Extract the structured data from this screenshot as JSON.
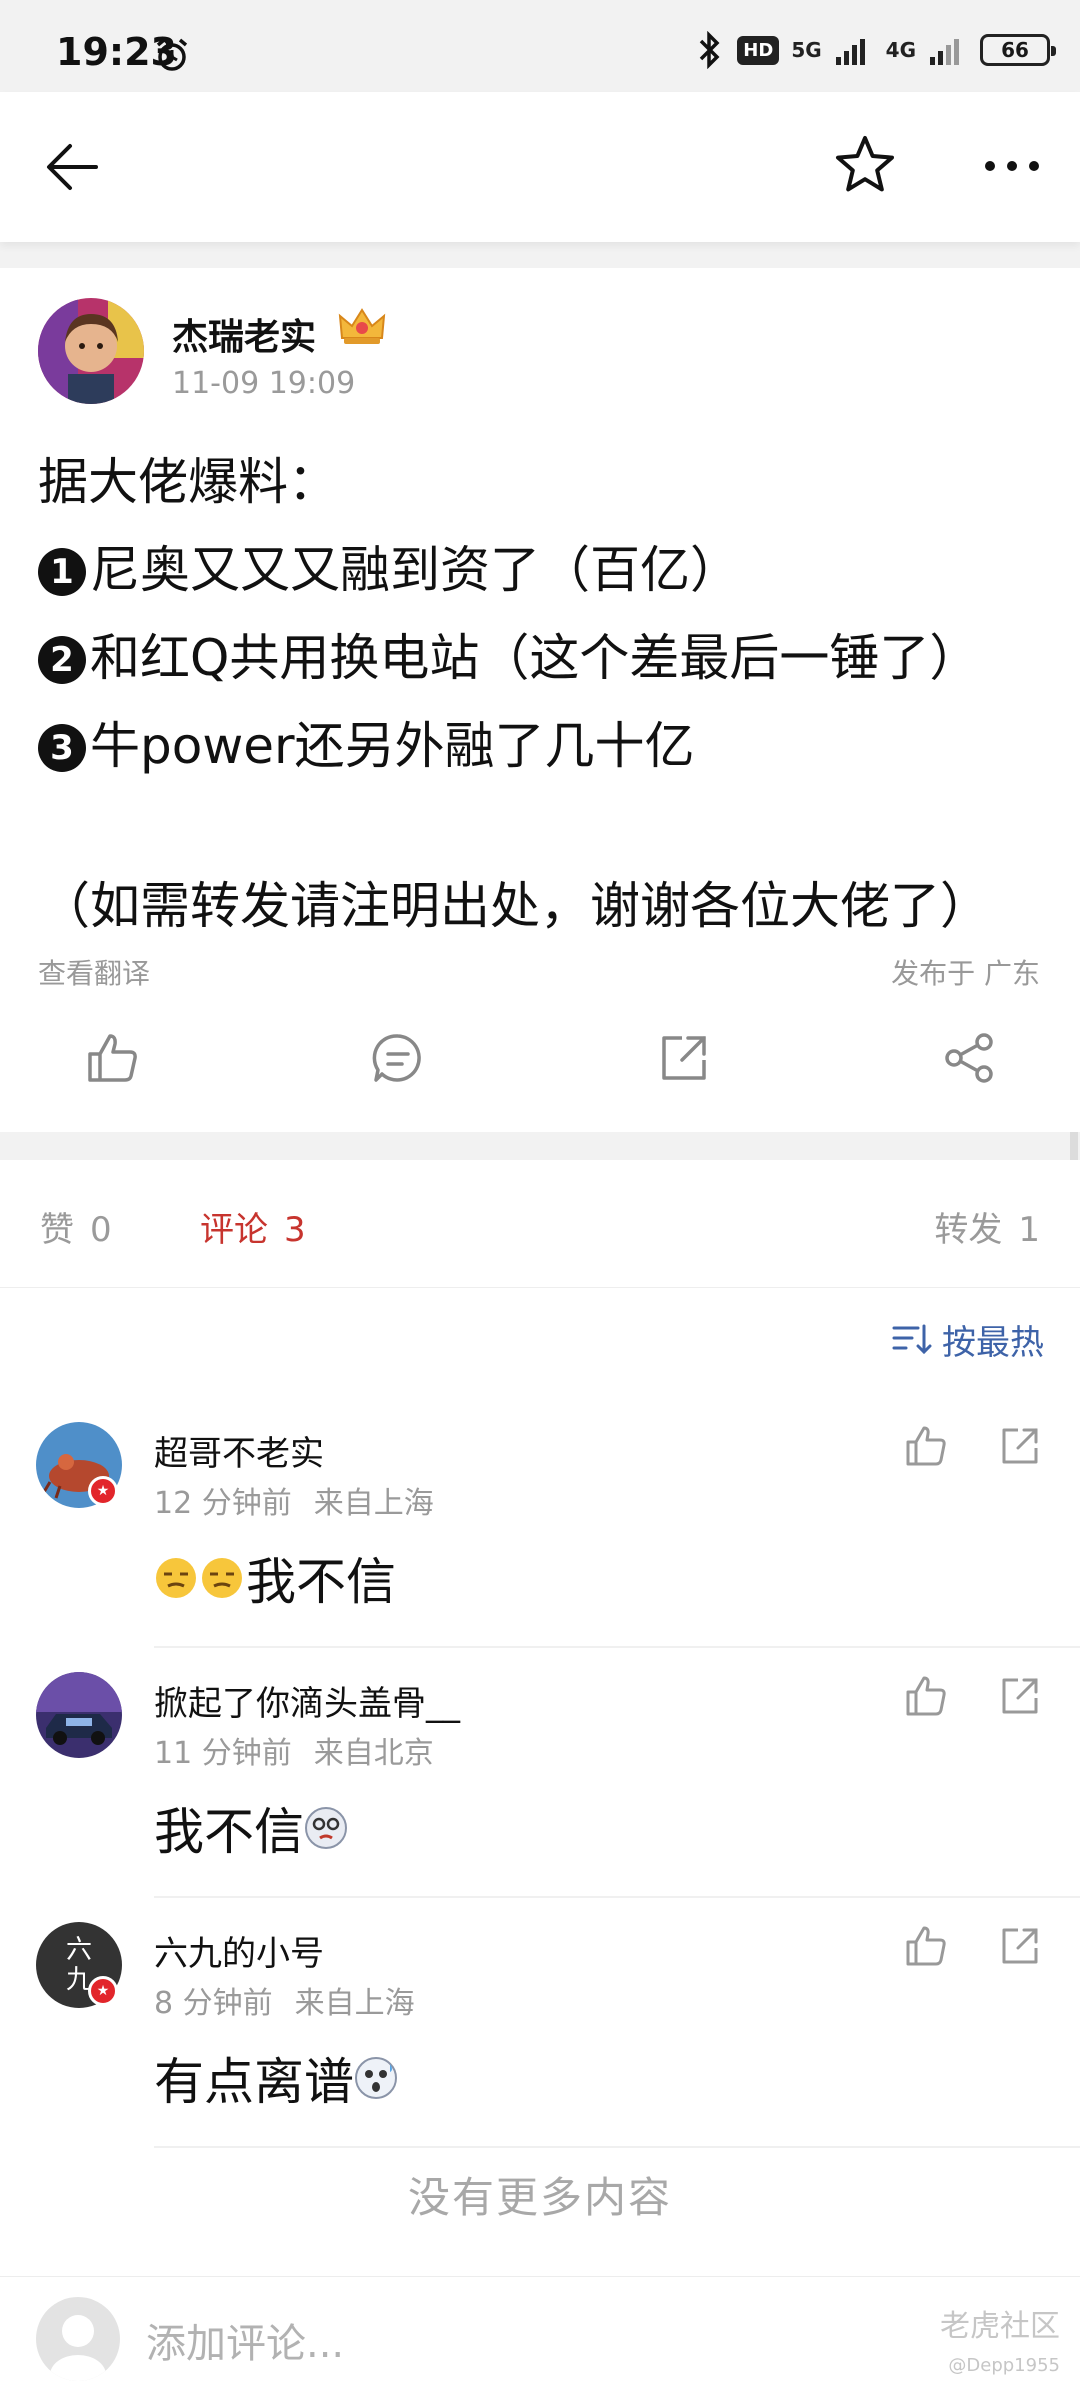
{
  "status_bar": {
    "time": "19:23",
    "network_hd": "HD",
    "net_5g": "5G",
    "net_4g": "4G",
    "battery": "66"
  },
  "post": {
    "author": "杰瑞老实",
    "time": "11-09 19:09",
    "lines": [
      "据大佬爆料：",
      "尼奥又又又融到资了（百亿）",
      "和红Q共用换电站（这个差最后一锤了）",
      "牛power还另外融了几十亿",
      "（如需转发请注明出处，谢谢各位大佬了）"
    ],
    "numbers": [
      "1",
      "2",
      "3"
    ],
    "translate_label": "查看翻译",
    "publish_location": "发布于 广东"
  },
  "stats": {
    "likes_label": "赞",
    "likes_count": "0",
    "comments_label": "评论",
    "comments_count": "3",
    "reposts_label": "转发",
    "reposts_count": "1"
  },
  "sort_label": "按最热",
  "comments": [
    {
      "name": "超哥不老实",
      "time": "12 分钟前",
      "location": "来自上海",
      "text": "我不信",
      "emoji_before": true
    },
    {
      "name": "掀起了你滴头盖骨__",
      "time": "11 分钟前",
      "location": "来自北京",
      "text": "我不信",
      "emoji_before": false
    },
    {
      "name": "六九的小号",
      "time": "8 分钟前",
      "location": "来自上海",
      "text": "有点离谱",
      "emoji_before": false,
      "avatar_text": "六九"
    }
  ],
  "no_more_label": "没有更多内容",
  "bottom": {
    "placeholder": "添加评论...",
    "watermark": "老虎社区",
    "watermark_user": "@Depp1955"
  },
  "colors": {
    "accent_red": "#c7342e",
    "link_blue": "#3e63a8",
    "muted_gray": "#9a9a9a"
  }
}
